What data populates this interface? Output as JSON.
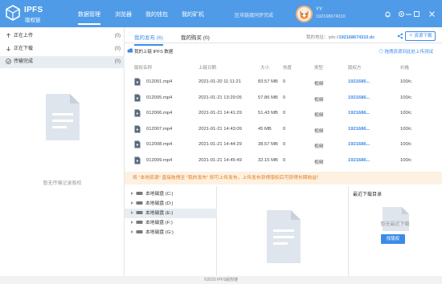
{
  "app": {
    "logo_title": "IPFS",
    "logo_sub": "版权链"
  },
  "nav": [
    {
      "label": "数据管理"
    },
    {
      "label": "浏览器"
    },
    {
      "label": "我的钱包"
    },
    {
      "label": "我的矿机"
    }
  ],
  "header": {
    "sync_status": "区块链度同步完成",
    "user_name": "YY",
    "user_id": "192168674310"
  },
  "sidebar": {
    "items": [
      {
        "icon": "upload-icon",
        "label": "正在上传",
        "count": "(0)"
      },
      {
        "icon": "download-icon",
        "label": "正在下载",
        "count": "(0)"
      },
      {
        "icon": "check-circle-icon",
        "label": "传输完成",
        "count": "(0)"
      }
    ],
    "empty_text": "暂无传输记录版权"
  },
  "tabs": [
    {
      "label": "我的发布 (6)"
    },
    {
      "label": "我的购买 (0)"
    }
  ],
  "address": {
    "label": "我的地址：ipfs://",
    "value": "192168674310.dc"
  },
  "upload_button": "＋ 资源下载",
  "subheader": {
    "title": "我的上链 IPFS 数据",
    "right": "◎ 拖拽资源到此处上传测试"
  },
  "table": {
    "headers": [
      "版权名称",
      "上链日期",
      "大小",
      "热度",
      "类型",
      "版权方",
      "价格"
    ],
    "rows": [
      {
        "name": "012001.mp4",
        "date": "2021-01-20 11:11:21",
        "size": "83.57 MB",
        "heat": "0",
        "type": "视频",
        "owner": "1921686...",
        "price": "100/c"
      },
      {
        "name": "012005.mp4",
        "date": "2021-01-21 13:29:05",
        "size": "57.86 MB",
        "heat": "0",
        "type": "视频",
        "owner": "1921686...",
        "price": "100/c"
      },
      {
        "name": "012006.mp4",
        "date": "2021-01-21 14:41:29",
        "size": "51.43 MB",
        "heat": "0",
        "type": "视频",
        "owner": "1921686...",
        "price": "100/c"
      },
      {
        "name": "012007.mp4",
        "date": "2021-01-21 14:43:09",
        "size": "45 MB",
        "heat": "0",
        "type": "视频",
        "owner": "1921686...",
        "price": "100/c"
      },
      {
        "name": "012008.mp4",
        "date": "2021-01-21 14:44:29",
        "size": "38.57 MB",
        "heat": "0",
        "type": "视频",
        "owner": "1921686...",
        "price": "100/c"
      },
      {
        "name": "012009.mp4",
        "date": "2021-01-21 14:45:49",
        "size": "32.15 MB",
        "heat": "0",
        "type": "视频",
        "owner": "1921686...",
        "price": "100/c"
      }
    ]
  },
  "notice": "将 \"本地资源\" 直接拖拽至 \"我的发布\" 即可上传发布，上传发布获得版权后可获得长期收益！",
  "tree": [
    {
      "label": "本地磁盘 (C:)"
    },
    {
      "label": "本地磁盘 (D:)"
    },
    {
      "label": "本地磁盘 (E:)"
    },
    {
      "label": "本地磁盘 (F:)"
    },
    {
      "label": "本地磁盘 (G:)"
    }
  ],
  "recent": {
    "title": "最近下载目录",
    "empty": "暂无最近下载",
    "button": "找版权"
  },
  "footer": "©2020 IPFS版权链",
  "colors": {
    "header": "#4f9be8",
    "accent": "#3c8ce7",
    "notice_bg": "#fdf1e2",
    "notice_text": "#e07d1a"
  }
}
